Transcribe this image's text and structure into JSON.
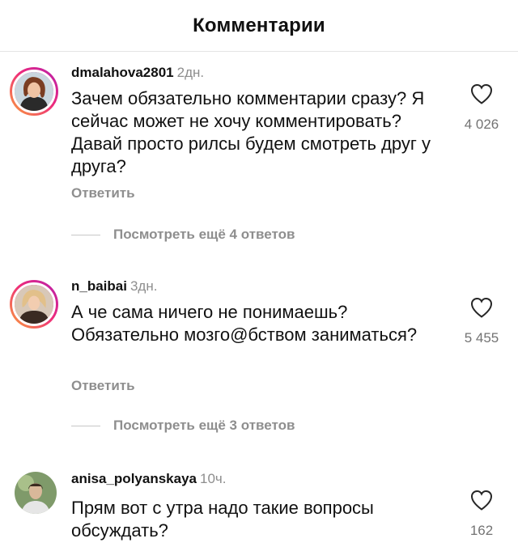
{
  "header": {
    "title": "Комментарии"
  },
  "comments": [
    {
      "username": "dmalahova2801",
      "time": "2дн.",
      "text": "Зачем обязательно комментарии сразу? Я сейчас может не хочу комментировать? Давай просто рилсы будем смотреть друг у друга?",
      "reply_label": "Ответить",
      "more_replies": "Посмотреть ещё 4 ответов",
      "likes": "4 026",
      "avatar_icon": "profile-photo",
      "has_story_ring": true
    },
    {
      "username": "n_baibai",
      "time": "3дн.",
      "text": "А че сама ничего не понимаешь? Обязательно мозго@бством заниматься?",
      "reply_label": "Ответить",
      "more_replies": "Посмотреть ещё 3 ответов",
      "likes": "5 455",
      "avatar_icon": "profile-photo",
      "has_story_ring": true
    },
    {
      "username": "anisa_polyanskaya",
      "time": "10ч.",
      "text": "Прям вот с утра надо такие вопросы обсуждать?",
      "likes": "162",
      "avatar_icon": "profile-photo",
      "has_story_ring": false
    }
  ],
  "colors": {
    "secondary_text": "#8e8e8e",
    "story_ring_start": "#f9a13a",
    "story_ring_end": "#b41fb0"
  },
  "icons": {
    "like": "heart-outline-icon"
  }
}
